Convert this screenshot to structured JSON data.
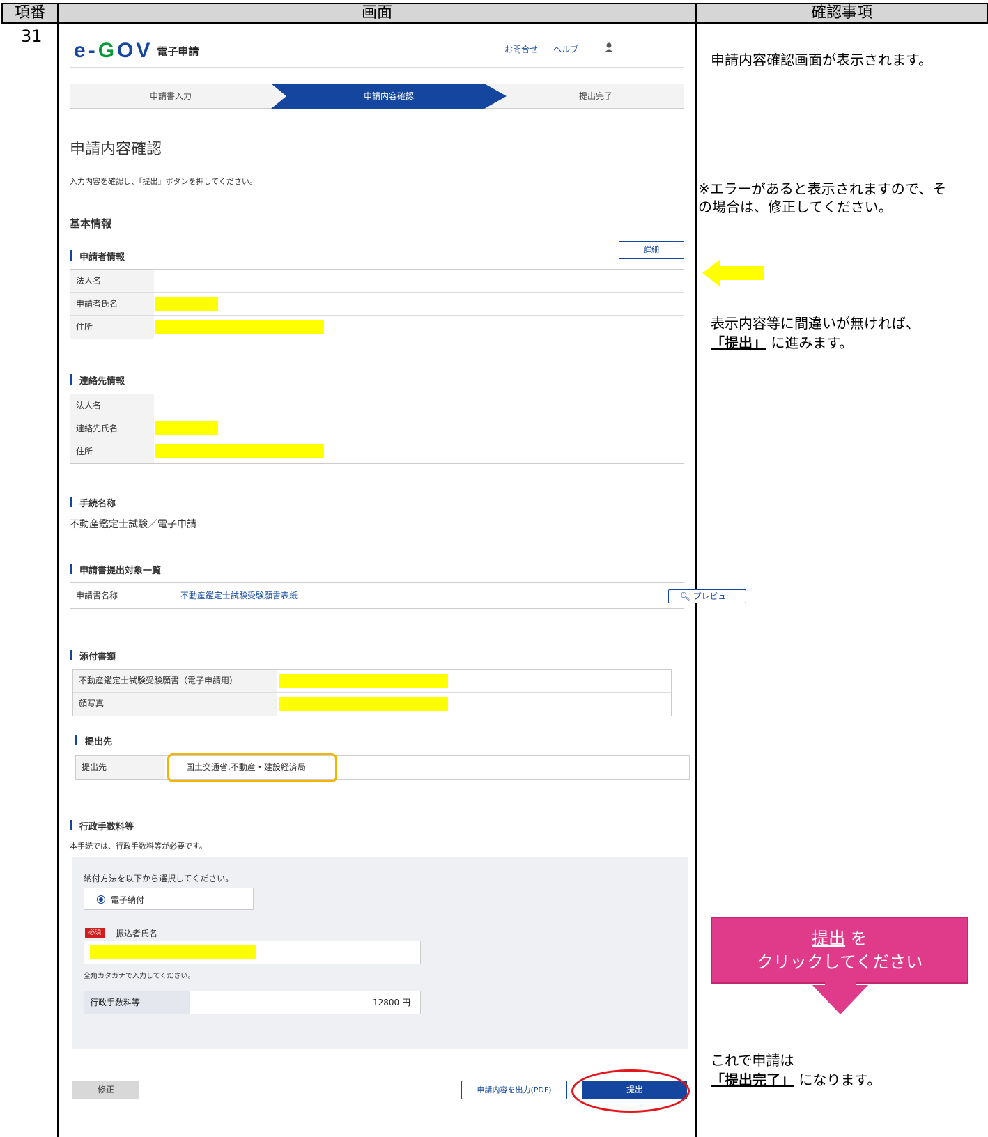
{
  "manual": {
    "headers": [
      "項番",
      "画面",
      "確認事項"
    ],
    "row_number": "31"
  },
  "app": {
    "logo_sub": "電子申請",
    "nav": {
      "contact": "お問合せ",
      "help": "ヘルプ"
    },
    "steps": [
      "申請書入力",
      "申請内容確認",
      "提出完了"
    ],
    "page_title": "申請内容確認",
    "lead": "入力内容を確認し、「提出」ボタンを押してください。",
    "basic_heading": "基本情報",
    "applicant": {
      "heading": "申請者情報",
      "detail_button": "詳細",
      "rows": [
        "法人名",
        "申請者氏名",
        "住所"
      ]
    },
    "contact": {
      "heading": "連絡先情報",
      "rows": [
        "法人名",
        "連絡先氏名",
        "住所"
      ]
    },
    "procedure": {
      "heading": "手続名称",
      "name": "不動産鑑定士試験／電子申請"
    },
    "application_list": {
      "heading": "申請書提出対象一覧",
      "label": "申請書名称",
      "document_link": "不動産鑑定士試験受験願書表紙",
      "preview_button": "プレビュー"
    },
    "attachments": {
      "heading": "添付書類",
      "rows": [
        "不動産鑑定士試験受験願書（電子申請用）",
        "顔写真"
      ]
    },
    "destination": {
      "heading": "提出先",
      "label": "提出先",
      "value": "国土交通省,不動産・建設経済局"
    },
    "fees": {
      "heading": "行政手数料等",
      "note": "本手続では、行政手数料等が必要です。",
      "method_prompt": "納付方法を以下から選択してください。",
      "method_selected": "電子納付",
      "required_badge": "必須",
      "payer_label": "振込者氏名",
      "payer_hint": "全角カタカナで入力してください。",
      "fee_label": "行政手数料等",
      "fee_value": "12800 円"
    },
    "buttons": {
      "fix": "修正",
      "pdf": "申請内容を出力(PDF)",
      "submit": "提出"
    }
  },
  "notes": {
    "screen_shown": "申請内容確認画面が表示されます。",
    "error_line1": "※エラーがあると表示されますので、そ",
    "error_line2": "の場合は、修正してください。",
    "ok_line1": "表示内容等に間違いが無ければ、",
    "ok_bold": "「提出」",
    "ok_line2_rest": " に進みます。",
    "callout_link": "提出",
    "callout_suffix": "を",
    "callout_line2": "クリックしてください",
    "done_line1": "これで申請は",
    "done_bold": "「提出完了」",
    "done_line2_rest": " になります。"
  },
  "colors": {
    "primary": "#1446a0",
    "highlight": "#ffff00",
    "callout": "#e03b8b",
    "annotation_red": "#e3171d",
    "annotation_orange": "#f5b400"
  }
}
